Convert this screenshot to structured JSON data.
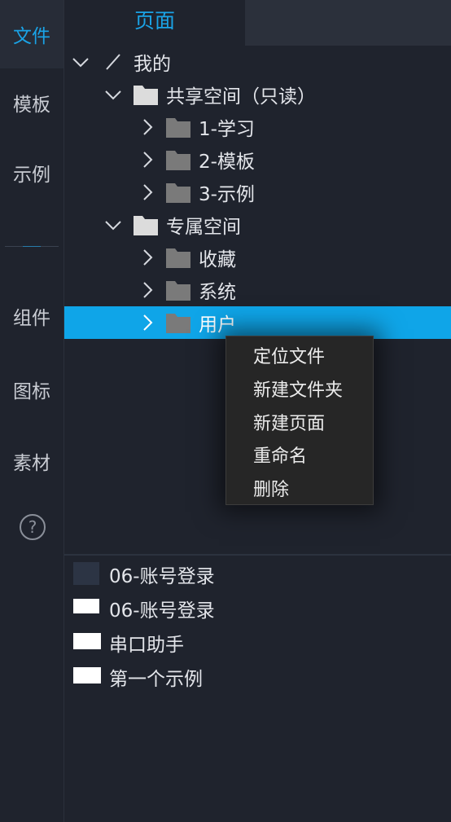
{
  "rail": {
    "items": [
      {
        "label": "文件",
        "active": true
      },
      {
        "label": "模板",
        "active": false
      },
      {
        "label": "示例",
        "active": false
      },
      {
        "label": "组件",
        "active": false
      },
      {
        "label": "图标",
        "active": false
      },
      {
        "label": "素材",
        "active": false
      }
    ],
    "help_icon": "?"
  },
  "tabs": {
    "active_label": "页面"
  },
  "tree": {
    "root": {
      "label": "我的",
      "icon": "slash-icon",
      "expanded": true
    },
    "shared": {
      "label": "共享空间（只读）",
      "expanded": true
    },
    "shared_items": [
      {
        "label": "1-学习"
      },
      {
        "label": "2-模板"
      },
      {
        "label": "3-示例"
      }
    ],
    "private": {
      "label": "专属空间",
      "expanded": true
    },
    "private_items": [
      {
        "label": "收藏"
      },
      {
        "label": "系统"
      },
      {
        "label": "用户",
        "selected": true
      }
    ]
  },
  "context_menu": {
    "items": [
      "定位文件",
      "新建文件夹",
      "新建页面",
      "重命名",
      "删除"
    ]
  },
  "files": [
    {
      "label": "06-账号登录",
      "thumb": "dark"
    },
    {
      "label": "06-账号登录",
      "thumb": "white"
    },
    {
      "label": "串口助手",
      "thumb": "white"
    },
    {
      "label": "第一个示例",
      "thumb": "white"
    }
  ],
  "colors": {
    "accent": "#1aa3e6",
    "selected_row": "#0fa5e8",
    "background": "#1f232d",
    "menu_bg": "#262626"
  }
}
